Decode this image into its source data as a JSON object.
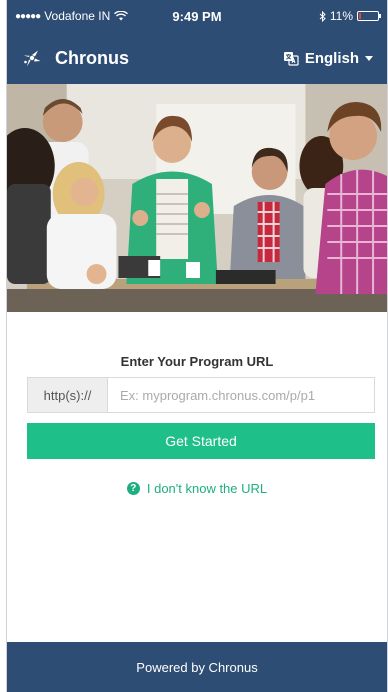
{
  "status_bar": {
    "carrier": "Vodafone IN",
    "signal_dots": "●●●●●",
    "time": "9:49 PM",
    "battery": "11%",
    "battery_level": 0.11
  },
  "nav": {
    "brand": "Chronus",
    "language": "English"
  },
  "form": {
    "title": "Enter Your Program URL",
    "prefix": "http(s)://",
    "url_value": "",
    "url_placeholder": "Ex: myprogram.chronus.com/p/p1",
    "submit_label": "Get Started",
    "help_label": "I don't know the URL"
  },
  "footer": {
    "text": "Powered by Chronus"
  },
  "colors": {
    "nav_bg": "#2e4d74",
    "accent": "#1fbf8a"
  },
  "icons": {
    "brand": "chronus-logo-icon",
    "language": "translate-icon",
    "help": "question-circle-icon"
  }
}
